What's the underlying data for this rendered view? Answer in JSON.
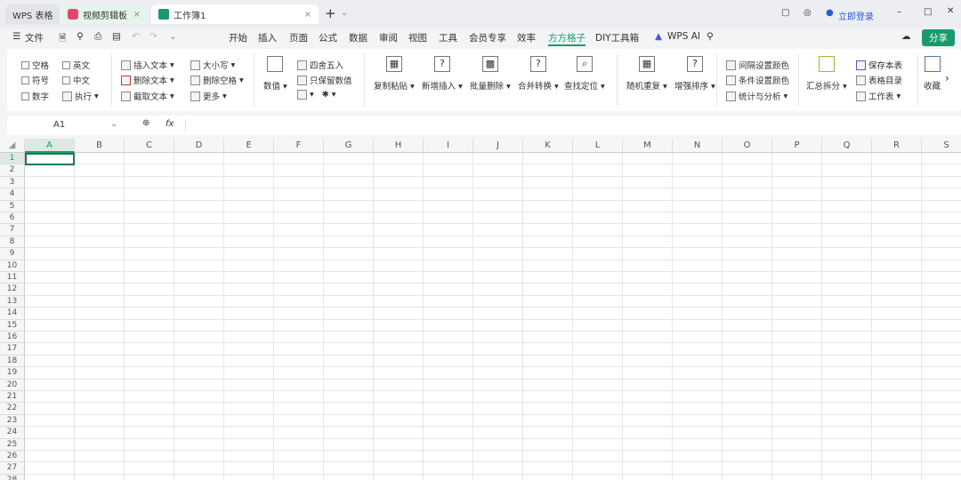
{
  "tabs": {
    "home": "WPS 表格",
    "t1": "视频剪辑板",
    "t2": "工作簿1",
    "new": "+",
    "login": "立即登录"
  },
  "menu": {
    "file": "文件",
    "items": [
      "开始",
      "插入",
      "页面",
      "公式",
      "数据",
      "审阅",
      "视图",
      "工具",
      "会员专享",
      "效率",
      "方方格子",
      "DIY工具箱"
    ],
    "ai": "WPS AI",
    "share": "分享"
  },
  "ribbon": {
    "g1": [
      "空格",
      "英文",
      "符号",
      "中文",
      "数字",
      "执行"
    ],
    "g2": [
      "插入文本",
      "删除文本",
      "截取文本"
    ],
    "g3": [
      "大小写",
      "删除空格",
      "更多"
    ],
    "g4": {
      "big": "数值",
      "items": [
        "四舍五入",
        "只保留数值"
      ]
    },
    "g5": [
      "复制粘贴",
      "新增插入",
      "批量删除",
      "合并转换",
      "查找定位"
    ],
    "g6": [
      "随机重复",
      "增强排序"
    ],
    "g7": [
      "间隔设置颜色",
      "条件设置颜色",
      "统计与分析"
    ],
    "g8": {
      "big": "汇总拆分",
      "items": [
        "保存本表",
        "表格目录",
        "工作表"
      ]
    },
    "g9": "收藏"
  },
  "formula": {
    "cell": "A1",
    "fx": "fx",
    "value": ""
  },
  "sheet": {
    "columns": [
      "A",
      "B",
      "C",
      "D",
      "E",
      "F",
      "G",
      "H",
      "I",
      "J",
      "K",
      "L",
      "M",
      "N",
      "O",
      "P",
      "Q",
      "R",
      "S"
    ],
    "rows": 28,
    "selected": "A1"
  },
  "colors": {
    "accent": "#1a9a6c",
    "tab_active": "#ffffff"
  }
}
